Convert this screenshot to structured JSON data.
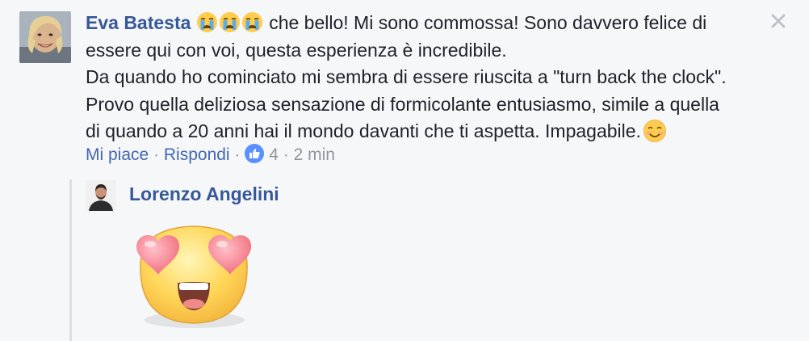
{
  "comment": {
    "author": "Eva Batesta",
    "reaction_emojis": [
      "crying-face",
      "crying-face",
      "crying-face"
    ],
    "text_lines": [
      " che bello! Mi sono commossa! Sono davvero felice di",
      "essere qui con voi, questa esperienza è incredibile.",
      "Da quando ho cominciato mi sembra di essere riuscita a \"turn back the clock\".",
      "Provo quella deliziosa sensazione di formicolante entusiasmo, simile a quella",
      "di quando a 20 anni hai il mondo davanti che ti aspetta. Impagabile."
    ],
    "trailing_emoji": "smiling-face",
    "actions": {
      "like_label": "Mi piace",
      "separator": " · ",
      "reply_label": "Rispondi",
      "like_count": "4",
      "timestamp": "2 min"
    },
    "close_icon": "close-icon"
  },
  "reply": {
    "author": "Lorenzo Angelini",
    "sticker": "heart-eyes-emoji"
  },
  "colors": {
    "background": "#f6f7f9",
    "author_link": "#365899",
    "action_link": "#4267b2",
    "meta_text": "#90949c",
    "like_badge": "#5890ff"
  }
}
